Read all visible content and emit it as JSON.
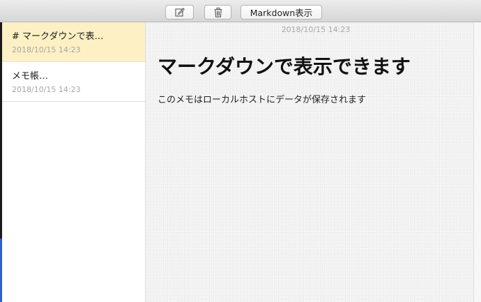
{
  "toolbar": {
    "compose_icon": "compose-icon",
    "trash_icon": "trash-icon",
    "markdown_label": "Markdown表示"
  },
  "notes": [
    {
      "title": "# マークダウンで表…",
      "date": "2018/10/15 14:23",
      "selected": true
    },
    {
      "title": "メモ帳…",
      "date": "2018/10/15 14:23",
      "selected": false
    }
  ],
  "content": {
    "date": "2018/10/15 14:23",
    "heading": "マークダウンで表示できます",
    "body": "このメモはローカルホストにデータが保存されます"
  },
  "colors": {
    "selected_note_bg": "#fdf0c4",
    "date_text": "#a7a7a7"
  }
}
